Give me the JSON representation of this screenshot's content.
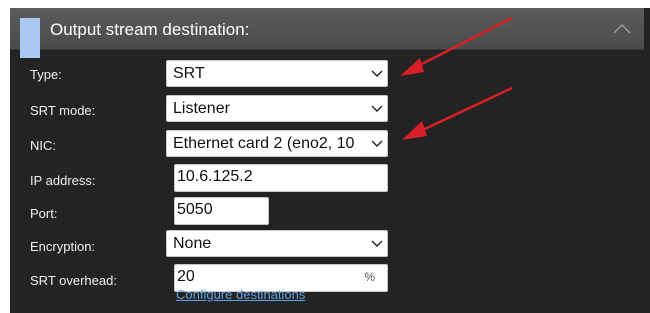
{
  "header": {
    "title": "Output stream destination:"
  },
  "fields": {
    "type": {
      "label": "Type:",
      "value": "SRT"
    },
    "srt_mode": {
      "label": "SRT mode:",
      "value": "Listener"
    },
    "nic": {
      "label": "NIC:",
      "value": "Ethernet card 2 (eno2, 10"
    },
    "ip_address": {
      "label": "IP address:",
      "value": "10.6.125.2"
    },
    "port": {
      "label": "Port:",
      "value": "5050"
    },
    "encryption": {
      "label": "Encryption:",
      "value": "None"
    },
    "srt_overhead": {
      "label": "SRT overhead:",
      "value": "20",
      "unit": "%"
    }
  },
  "link": {
    "label": "Configure destinations"
  },
  "colors": {
    "accent": "#a9c9f3",
    "annotation_arrow": "#d61f26",
    "link": "#5fa3e6"
  },
  "icons": {
    "collapse": "chevron-up-icon",
    "dropdown": "chevron-down-icon"
  }
}
